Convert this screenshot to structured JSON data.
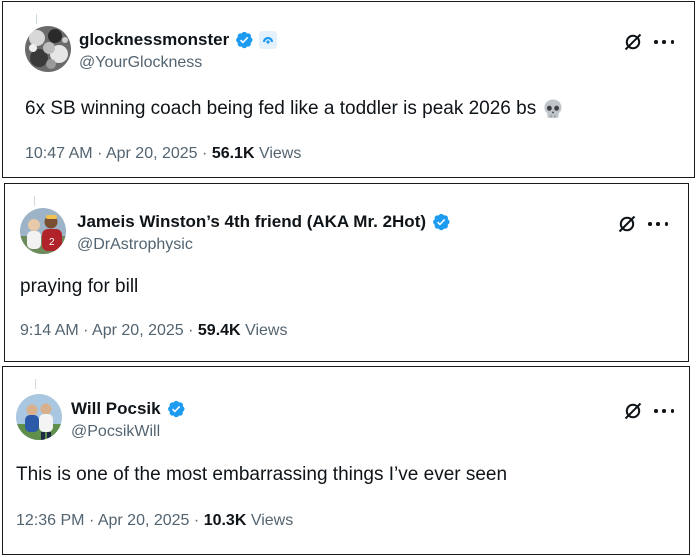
{
  "tweets": [
    {
      "name": "glocknessmonster",
      "handle": "@YourGlockness",
      "text": "6x SB winning coach being fed like a toddler is peak 2026 bs",
      "emoji": "skull",
      "time": "10:47 AM",
      "sep1": "·",
      "date": "Apr 20, 2025",
      "sep2": "·",
      "views_count": "56.1K",
      "views_label": "Views",
      "verified": true,
      "affiliate_badge": true
    },
    {
      "name": "Jameis Winston’s 4th friend (AKA Mr. 2Hot)",
      "handle": "@DrAstrophysic",
      "text": "praying for bill",
      "time": "9:14 AM",
      "sep1": "·",
      "date": "Apr 20, 2025",
      "sep2": "·",
      "views_count": "59.4K",
      "views_label": "Views",
      "verified": true
    },
    {
      "name": "Will Pocsik",
      "handle": "@PocsikWill",
      "text": "This is one of the most embarrassing things I’ve ever seen",
      "time": "12:36 PM",
      "sep1": "·",
      "date": "Apr 20, 2025",
      "sep2": "·",
      "views_count": "10.3K",
      "views_label": "Views",
      "verified": true
    }
  ],
  "colors": {
    "verified_blue": "#1d9bf0",
    "secondary_text": "#536471",
    "primary_text": "#0f1419",
    "border": "#1a1a1a"
  },
  "icons": [
    "grok-icon",
    "more-options-icon",
    "verified-badge-icon",
    "skull-emoji-icon"
  ]
}
